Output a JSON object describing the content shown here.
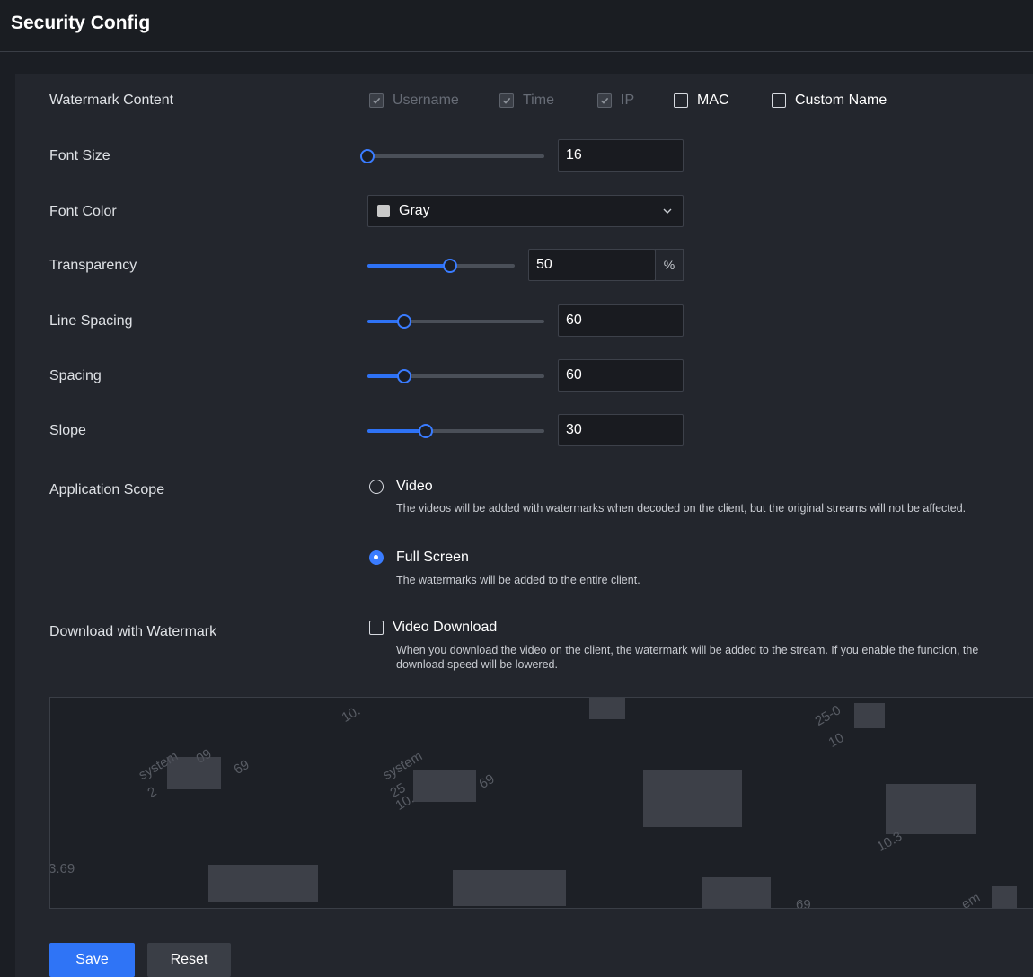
{
  "header": {
    "title": "Security Config"
  },
  "form": {
    "watermark_content": {
      "label": "Watermark Content",
      "options": [
        {
          "label": "Username",
          "checked": true,
          "disabled": true
        },
        {
          "label": "Time",
          "checked": true,
          "disabled": true
        },
        {
          "label": "IP",
          "checked": true,
          "disabled": true
        },
        {
          "label": "MAC",
          "checked": false,
          "disabled": false
        },
        {
          "label": "Custom Name",
          "checked": false,
          "disabled": false
        }
      ]
    },
    "font_size": {
      "label": "Font Size",
      "value": "16",
      "slider_fraction": 0.0
    },
    "font_color": {
      "label": "Font Color",
      "value": "Gray",
      "swatch": "#c9c9c9"
    },
    "transparency": {
      "label": "Transparency",
      "value": "50",
      "unit": "%",
      "slider_fraction": 0.56
    },
    "line_spacing": {
      "label": "Line Spacing",
      "value": "60",
      "slider_fraction": 0.21
    },
    "spacing": {
      "label": "Spacing",
      "value": "60",
      "slider_fraction": 0.21
    },
    "slope": {
      "label": "Slope",
      "value": "30",
      "slider_fraction": 0.33
    },
    "application_scope": {
      "label": "Application Scope",
      "options": [
        {
          "label": "Video",
          "selected": false,
          "description": "The videos will be added with watermarks when decoded on the client, but the original streams will not be affected."
        },
        {
          "label": "Full Screen",
          "selected": true,
          "description": "The watermarks will be added to the entire client."
        }
      ]
    },
    "download": {
      "label": "Download with Watermark",
      "option": {
        "label": "Video Download",
        "checked": false
      },
      "description": "When you download the video on the client, the watermark will be added to the stream. If you enable the function, the download speed will be lowered."
    }
  },
  "preview": {
    "fragments": [
      "10.",
      "25-0",
      "10",
      "system",
      "09",
      "2",
      "69",
      "system",
      "25",
      "69",
      "10.",
      "10.3",
      "3.69",
      "69",
      "em"
    ]
  },
  "actions": {
    "save_label": "Save",
    "reset_label": "Reset"
  },
  "colors": {
    "accent": "#2f74f6",
    "background": "#1b1e24",
    "panel": "#23262d"
  }
}
